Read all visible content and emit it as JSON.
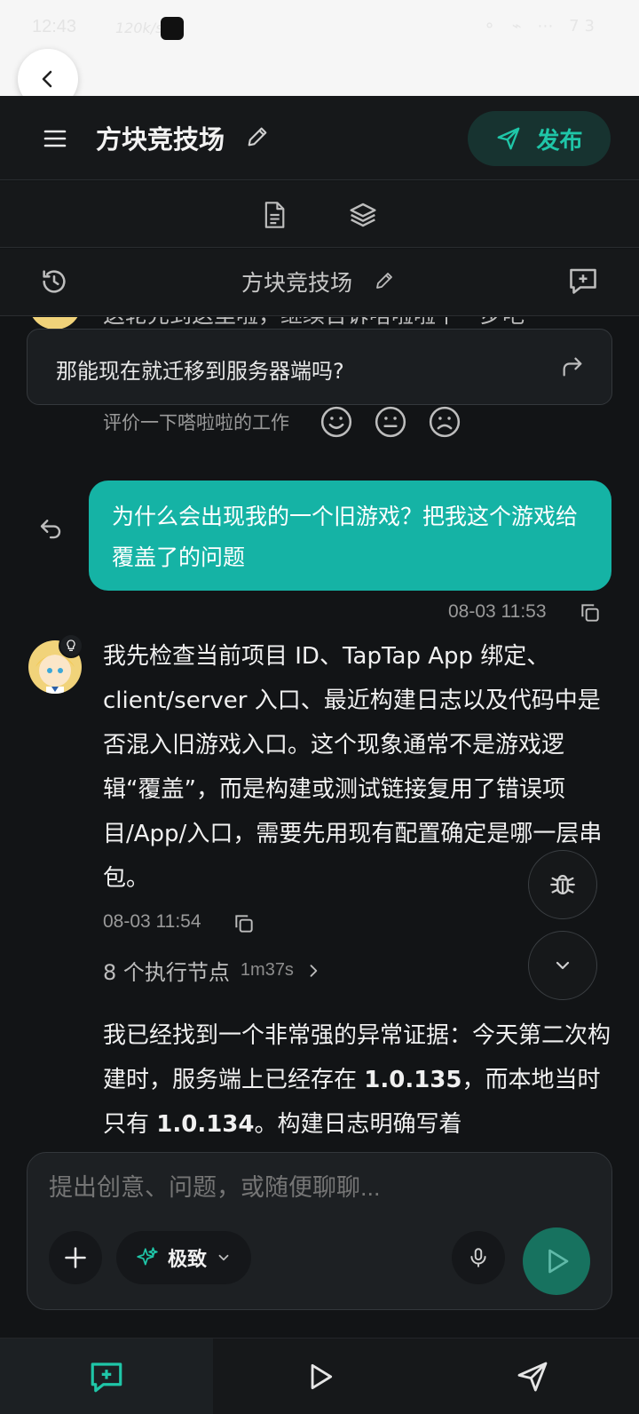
{
  "colors": {
    "accent": "#15b3a5",
    "background": "#121416",
    "header": "#16181a",
    "publish_text": "#1fc6a8",
    "send": "#17725f"
  },
  "status_bar": {
    "time": "12:43",
    "speed": "120k/s",
    "battery": "73"
  },
  "header": {
    "title": "方块竞技场",
    "publish_label": "发布"
  },
  "chat": {
    "title": "方块竞技场"
  },
  "messages": {
    "cutoff_text": "这轮先到这里啦，继续告诉嗒啦啦下一步吧",
    "suggestion": "那能现在就迁移到服务器端吗?",
    "feedback_label": "评价一下嗒啦啦的工作",
    "user_message": "为什么会出现我的一个旧游戏？把我这个游戏给覆盖了的问题",
    "user_time": "08-03 11:53",
    "ai_message": "我先检查当前项目 ID、TapTap App 绑定、client/server 入口、最近构建日志以及代码中是否混入旧游戏入口。这个现象通常不是游戏逻辑“覆盖”，而是构建或测试链接复用了错误项目/App/入口，需要先用现有配置确定是哪一层串包。",
    "ai_time": "08-03 11:54",
    "nodes_label": "8 个执行节点",
    "nodes_time": "1m37s",
    "ai_message_2_a": "我已经找到一个非常强的异常证据：今天第二次构建时，服务端上已经存在 ",
    "ai_message_2_b": "1.0.135",
    "ai_message_2_c": "，而本地当时只有 ",
    "ai_message_2_d": "1.0.134",
    "ai_message_2_e": "。构建日志明确写着"
  },
  "composer": {
    "placeholder": "提出创意、问题，或随便聊聊...",
    "mode_label": "极致"
  },
  "icons": [
    "chevron-left-icon",
    "menu-icon",
    "pencil-icon",
    "send-icon",
    "document-icon",
    "layers-icon",
    "history-icon",
    "new-chat-icon",
    "forward-icon",
    "smile-icon",
    "neutral-icon",
    "frown-icon",
    "retry-icon",
    "copy-icon",
    "bulb-icon",
    "bug-icon",
    "chevron-down-icon",
    "chevron-right-icon",
    "plus-icon",
    "sparkle-icon",
    "mic-icon",
    "play-icon"
  ]
}
